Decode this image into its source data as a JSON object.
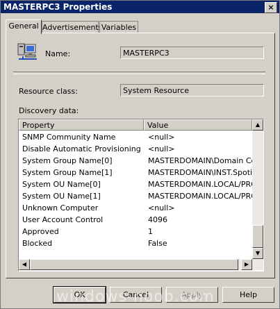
{
  "window": {
    "title": "MASTERPC3 Properties",
    "close_glyph": "×"
  },
  "tabs": [
    {
      "label": "General"
    },
    {
      "label": "Advertisements"
    },
    {
      "label": "Variables"
    }
  ],
  "general": {
    "name_label": "Name:",
    "name_value": "MASTERPC3",
    "resource_class_label": "Resource class:",
    "resource_class_value": "System Resource",
    "discovery_label": "Discovery data:"
  },
  "table": {
    "columns": [
      "Property",
      "Value"
    ],
    "rows": [
      {
        "property": "SNMP Community Name",
        "value": "<null>"
      },
      {
        "property": "Disable Automatic Provisioning",
        "value": "<null>"
      },
      {
        "property": "System Group Name[0]",
        "value": "MASTERDOMAIN\\Domain Comp"
      },
      {
        "property": "System Group Name[1]",
        "value": "MASTERDOMAIN\\INST.Spotify"
      },
      {
        "property": "System OU Name[0]",
        "value": "MASTERDOMAIN.LOCAL/PROD"
      },
      {
        "property": "System OU Name[1]",
        "value": "MASTERDOMAIN.LOCAL/PROD"
      },
      {
        "property": "Unknown Computer",
        "value": "<null>"
      },
      {
        "property": "User Account Control",
        "value": "4096"
      },
      {
        "property": "Approved",
        "value": "1"
      },
      {
        "property": "Blocked",
        "value": "False"
      }
    ]
  },
  "buttons": {
    "ok": "OK",
    "cancel": "Cancel",
    "apply": "Apply",
    "help": "Help"
  },
  "watermark": "windows-noob.com",
  "colors": {
    "titlebar": "#0a246a",
    "face": "#d4d0c8"
  }
}
